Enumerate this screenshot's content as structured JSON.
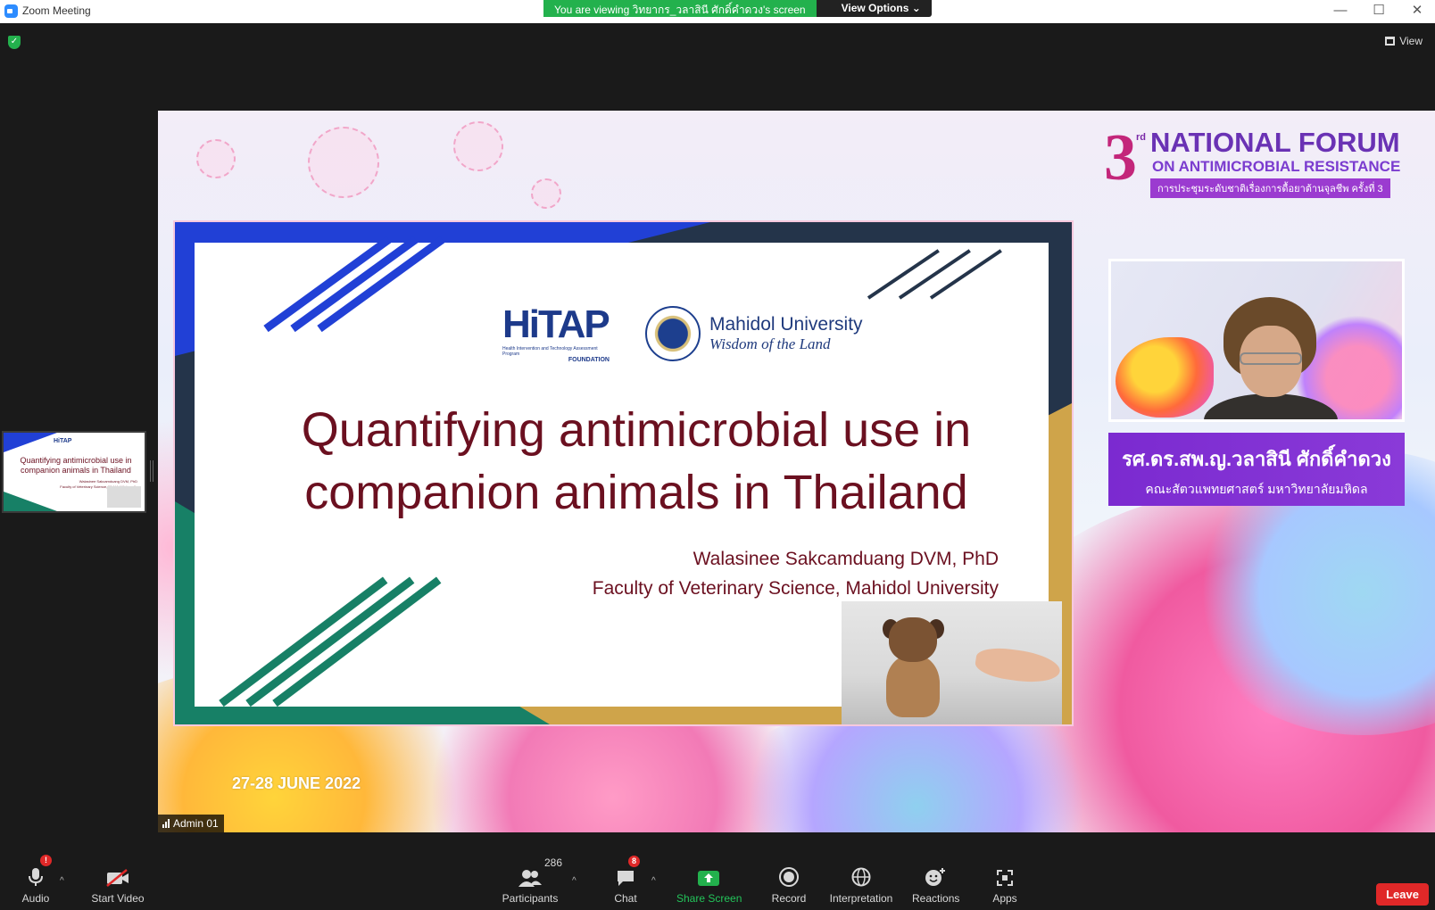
{
  "window": {
    "title": "Zoom Meeting",
    "view_banner": "You are viewing วิทยากร_วลาสินี ศักดิ์คำดวง's screen",
    "view_options": "View Options",
    "minimize": "—",
    "maximize": "☐",
    "close": "✕"
  },
  "top": {
    "view_label": "View"
  },
  "slide": {
    "forum_number": "3",
    "forum_ordinal": "rd",
    "forum_line1": "NATIONAL FORUM",
    "forum_line2": "ON ANTIMICROBIAL RESISTANCE",
    "forum_line3": "การประชุมระดับชาติเรื่องการดื้อยาต้านจุลชีพ ครั้งที่ 3",
    "date": "27-28 JUNE 2022",
    "hitap": "HiTAP",
    "hitap_sub": "Health Intervention and Technology Assessment Program",
    "hitap_foundation": "FOUNDATION",
    "mahidol_name": "Mahidol University",
    "mahidol_motto": "Wisdom of the Land",
    "title_line1": "Quantifying antimicrobial use in",
    "title_line2": "companion animals in Thailand",
    "author": "Walasinee Sakcamduang DVM, PhD",
    "affiliation": "Faculty of Veterinary Science, Mahidol University",
    "speaker_name": "รศ.ดร.สพ.ญ.วลาสินี ศักดิ์คำดวง",
    "speaker_faculty": "คณะสัตวแพทยศาสตร์ มหาวิทยาลัยมหิดล",
    "admin_label": "Admin 01"
  },
  "thumbnail": {
    "title": "Quantifying antimicrobial use in companion animals in Thailand",
    "logo": "HiTAP",
    "author": "Walasinee Sakcamduang DVM, PhD",
    "affiliation": "Faculty of Veterinary Science, Mahidol University"
  },
  "toolbar": {
    "audio": "Audio",
    "audio_badge": "!",
    "start_video": "Start Video",
    "participants": "Participants",
    "participants_count": "286",
    "chat": "Chat",
    "chat_badge": "8",
    "share_screen": "Share Screen",
    "record": "Record",
    "interpretation": "Interpretation",
    "reactions": "Reactions",
    "apps": "Apps",
    "leave": "Leave"
  },
  "colors": {
    "zoom_blue": "#2d8cff",
    "banner_green": "#23b14d",
    "leave_red": "#e02828",
    "slide_title": "#6b1020",
    "forum_purple": "#6a32b4"
  }
}
